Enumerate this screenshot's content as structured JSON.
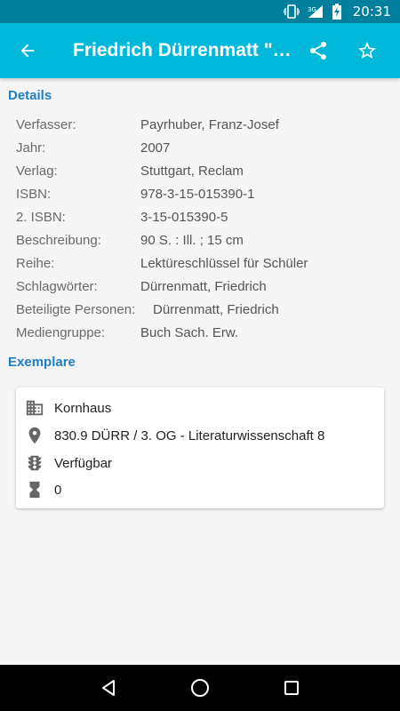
{
  "status_bar": {
    "time": "20:31",
    "network": "3G"
  },
  "app_bar": {
    "title": "Friedrich Dürrenmatt \"Der Besuch der alten Dame\""
  },
  "sections": {
    "details": "Details",
    "copies": "Exemplare"
  },
  "details": [
    {
      "label": "Verfasser:",
      "value": "Payrhuber, Franz-Josef"
    },
    {
      "label": "Jahr:",
      "value": "2007"
    },
    {
      "label": "Verlag:",
      "value": "Stuttgart, Reclam"
    },
    {
      "label": "ISBN:",
      "value": "978-3-15-015390-1"
    },
    {
      "label": "2. ISBN:",
      "value": "3-15-015390-5"
    },
    {
      "label": "Beschreibung:",
      "value": "90 S. : Ill. ; 15 cm"
    },
    {
      "label": "Reihe:",
      "value": "Lektüreschlüssel für Schüler"
    },
    {
      "label": "Schlagwörter:",
      "value": "Dürrenmatt, Friedrich"
    },
    {
      "label": "Beteiligte Personen:",
      "value": "Dürrenmatt, Friedrich"
    },
    {
      "label": "Mediengruppe:",
      "value": "Buch Sach. Erw."
    }
  ],
  "copy": {
    "branch": "Kornhaus",
    "location": "830.9 DÜRR / 3. OG - Literaturwissenschaft 8",
    "status": "Verfügbar",
    "reservations": "0"
  },
  "icons": {
    "branch": "building-icon",
    "location": "location-pin-icon",
    "status": "traffic-light-icon",
    "reservations": "hourglass-icon"
  },
  "colors": {
    "status_bar": "#00809c",
    "app_bar": "#00b8d9",
    "section_title": "#1f7fc4"
  }
}
